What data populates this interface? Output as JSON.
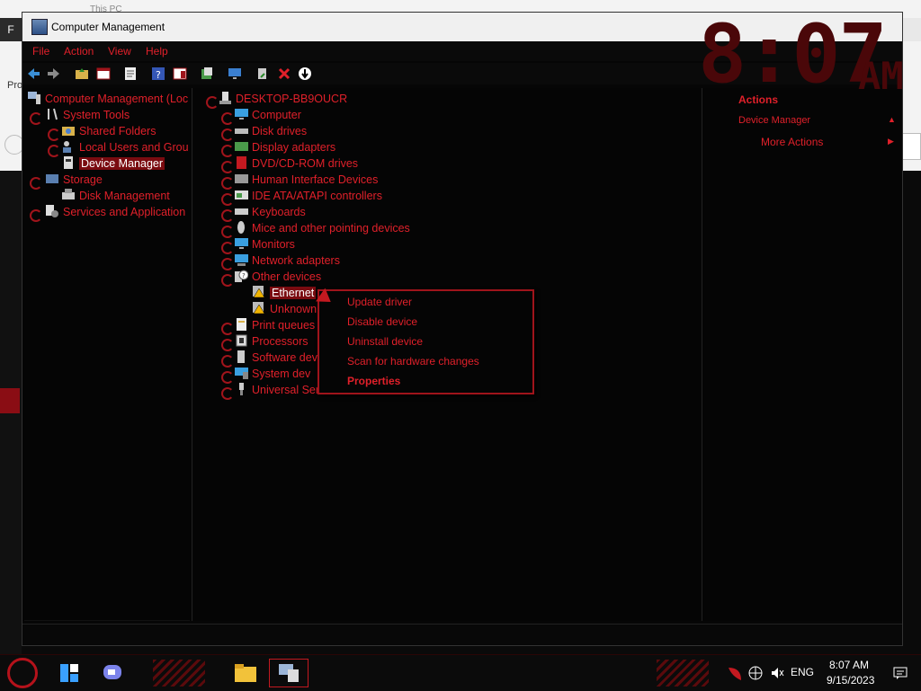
{
  "background": {
    "explorer_title": "This PC",
    "explorer_tab": "F",
    "explorer_left_text": "Pro"
  },
  "clock_overlay": {
    "time": "8:07",
    "ampm": "AM"
  },
  "window": {
    "title": "Computer Management",
    "menu": [
      "File",
      "Action",
      "View",
      "Help"
    ]
  },
  "left_tree": [
    {
      "label": "Computer Management (Loc",
      "icon": "computer-management-icon"
    },
    {
      "label": "System Tools",
      "icon": "tools-icon"
    },
    {
      "label": "Shared Folders",
      "icon": "shared-folder-icon"
    },
    {
      "label": "Local Users and Grou",
      "icon": "users-icon"
    },
    {
      "label": "Device Manager",
      "icon": "device-manager-icon",
      "selected": true
    },
    {
      "label": "Storage",
      "icon": "storage-icon"
    },
    {
      "label": "Disk Management",
      "icon": "disk-icon"
    },
    {
      "label": "Services and Application",
      "icon": "services-icon"
    }
  ],
  "device_tree": {
    "root": "DESKTOP-BB9OUCR",
    "items": [
      {
        "label": "Computer",
        "icon": "monitor-icon"
      },
      {
        "label": "Disk drives",
        "icon": "disk-drive-icon"
      },
      {
        "label": "Display adapters",
        "icon": "display-adapter-icon"
      },
      {
        "label": "DVD/CD-ROM drives",
        "icon": "dvd-icon"
      },
      {
        "label": "Human Interface Devices",
        "icon": "hid-icon"
      },
      {
        "label": "IDE ATA/ATAPI controllers",
        "icon": "ide-icon"
      },
      {
        "label": "Keyboards",
        "icon": "keyboard-icon"
      },
      {
        "label": "Mice and other pointing devices",
        "icon": "mouse-icon"
      },
      {
        "label": "Monitors",
        "icon": "monitor-icon"
      },
      {
        "label": "Network adapters",
        "icon": "network-icon"
      },
      {
        "label": "Other devices",
        "icon": "unknown-device-icon"
      }
    ],
    "other_devices": [
      {
        "label": "Ethernet",
        "icon": "warning-device-icon"
      },
      {
        "label": "Unknown",
        "icon": "warning-device-icon"
      }
    ],
    "items_after": [
      {
        "label": "Print queues",
        "icon": "printer-icon"
      },
      {
        "label": "Processors",
        "icon": "processor-icon"
      },
      {
        "label": "Software dev",
        "icon": "software-device-icon"
      },
      {
        "label": "System dev",
        "icon": "system-device-icon"
      },
      {
        "label": "Universal Serial Bus controllers",
        "icon": "usb-icon"
      }
    ]
  },
  "context_menu": {
    "items": [
      "Update driver",
      "Disable device",
      "Uninstall device",
      "Scan for hardware changes",
      "Properties"
    ]
  },
  "actions_pane": {
    "header": "Actions",
    "section": "Device Manager",
    "more": "More Actions"
  },
  "taskbar": {
    "language": "ENG",
    "time": "8:07 AM",
    "date": "9/15/2023"
  },
  "colors": {
    "accent": "#e0202a",
    "selection": "#7a0b10",
    "border": "#a0141b"
  }
}
